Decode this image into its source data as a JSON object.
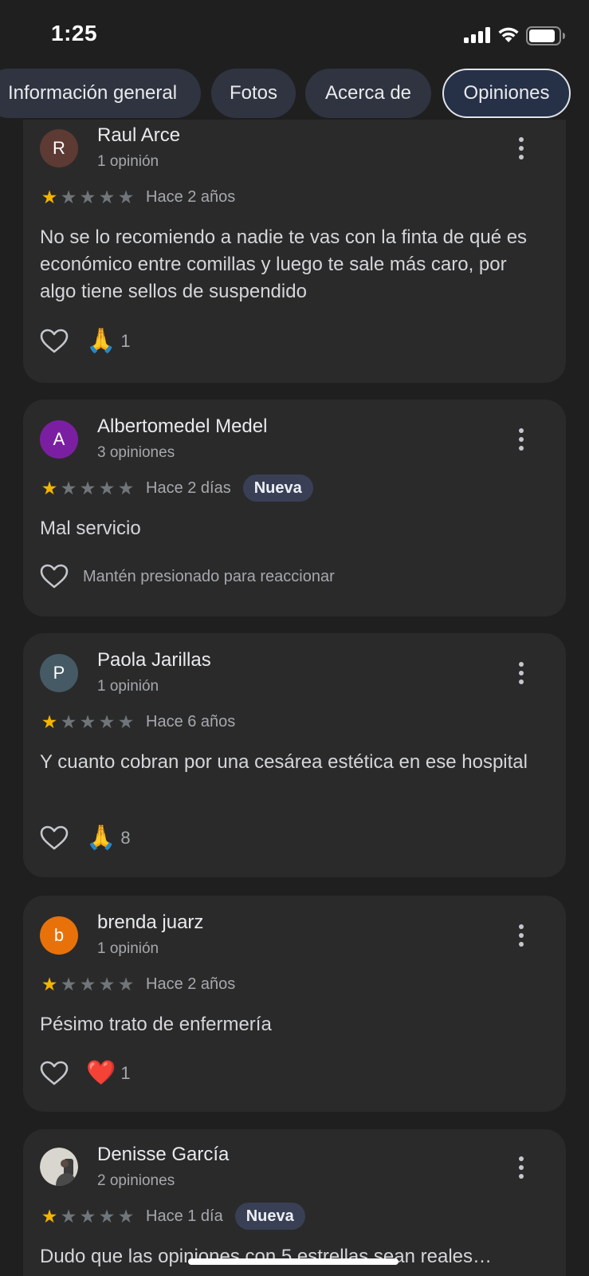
{
  "status_bar": {
    "time": "1:25"
  },
  "tabs": [
    {
      "label": "Información general"
    },
    {
      "label": "Fotos"
    },
    {
      "label": "Acerca de"
    },
    {
      "label": "Opiniones"
    }
  ],
  "active_tab": "Opiniones",
  "colors": {
    "star_filled": "#f4b400",
    "star_empty": "#70757a",
    "avatar_raul": "#5d3a33",
    "avatar_albertomedel": "#7b1fa2",
    "avatar_paola": "#455a64",
    "avatar_brenda": "#e8710a"
  },
  "reviews": [
    {
      "initial": "R",
      "name": "Raul Arce",
      "count": "1 opinión",
      "rating": 1,
      "time": "Hace 2 años",
      "text": "No se lo recomiendo a nadie te vas con la finta de qué es económico entre comillas y luego te sale más caro, por algo tiene sellos de suspendido",
      "reaction_emoji": "🙏",
      "reaction_count": "1"
    },
    {
      "initial": "A",
      "name": "Albertomedel Medel",
      "count": "3 opiniones",
      "rating": 1,
      "time": "Hace 2 días",
      "badge": "Nueva",
      "text": "Mal servicio",
      "reaction_hint": "Mantén presionado para reaccionar"
    },
    {
      "initial": "P",
      "name": "Paola Jarillas",
      "count": "1 opinión",
      "rating": 1,
      "time": "Hace 6 años",
      "text": "Y cuanto cobran por una cesárea estética en ese hospital",
      "reaction_emoji": "🙏",
      "reaction_count": "8"
    },
    {
      "initial": "b",
      "name": "brenda juarz",
      "count": "1 opinión",
      "rating": 1,
      "time": "Hace 2 años",
      "text": "Pésimo trato de enfermería",
      "reaction_emoji": "❤️",
      "reaction_count": "1"
    },
    {
      "name": "Denisse García",
      "count": "2 opiniones",
      "rating": 1,
      "time": "Hace 1 día",
      "badge": "Nueva",
      "text": "Dudo que las opiniones con 5 estrellas sean reales…"
    }
  ]
}
